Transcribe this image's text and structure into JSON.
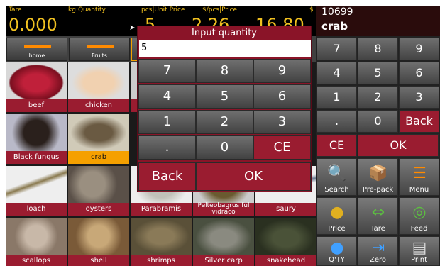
{
  "topbar": {
    "tare_label": "Tare",
    "tare_value": "0.000",
    "qty_label": "kg|Quantity",
    "qty_value": "5",
    "unitprice_label": "pcs|Unit Price",
    "unitprice_value": "2.26",
    "price_label": "$/pcs|Price",
    "price_unit": "$",
    "price_value": "16.80"
  },
  "plu": {
    "code": "10699",
    "name": "crab"
  },
  "categories": [
    {
      "label": "home"
    },
    {
      "label": "Fruits"
    }
  ],
  "products": [
    {
      "label": "beef"
    },
    {
      "label": "chicken"
    },
    {
      "label": "Black fungus"
    },
    {
      "label": "crab"
    },
    {
      "label": "loach"
    },
    {
      "label": "oysters"
    },
    {
      "label": "Parabramis"
    },
    {
      "label": "Pelteobagrus ful vidraco"
    },
    {
      "label": "saury"
    },
    {
      "label": "scallops"
    },
    {
      "label": "shell"
    },
    {
      "label": "shrimps"
    },
    {
      "label": "Silver carp"
    },
    {
      "label": "snakehead"
    }
  ],
  "keypad": {
    "keys": [
      "7",
      "8",
      "9",
      "4",
      "5",
      "6",
      "1",
      "2",
      "3",
      ".",
      "0",
      "Back"
    ],
    "ce": "CE",
    "ok": "OK"
  },
  "functions": [
    {
      "label": "Search",
      "icon": "search-icon"
    },
    {
      "label": "Pre-pack",
      "icon": "pre-pack-icon"
    },
    {
      "label": "Menu",
      "icon": "menu-icon"
    },
    {
      "label": "Price",
      "icon": "price-icon"
    },
    {
      "label": "Tare",
      "icon": "tare-icon"
    },
    {
      "label": "Feed",
      "icon": "feed-icon"
    },
    {
      "label": "Q'TY",
      "icon": "qty-icon"
    },
    {
      "label": "Zero",
      "icon": "zero-icon"
    },
    {
      "label": "Print",
      "icon": "print-icon"
    }
  ],
  "dialog": {
    "title": "Input quantity",
    "value": "5",
    "keys": [
      "7",
      "8",
      "9",
      "4",
      "5",
      "6",
      "1",
      "2",
      "3",
      ".",
      "0",
      "CE"
    ],
    "back": "Back",
    "ok": "OK"
  },
  "colors": {
    "accent": "#9a1c30",
    "selected": "#f5a000",
    "display": "#f0c020"
  }
}
